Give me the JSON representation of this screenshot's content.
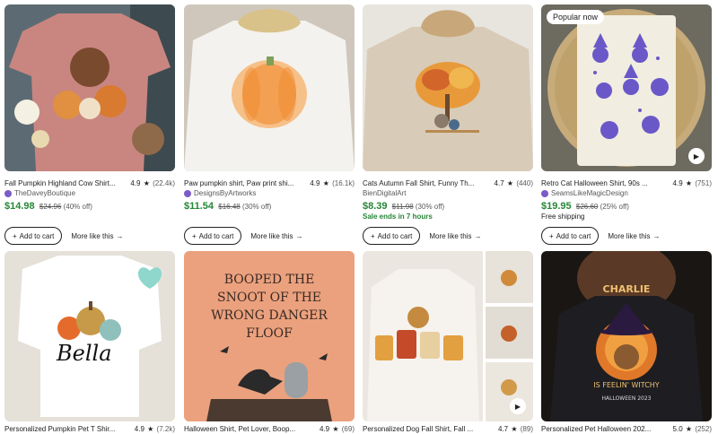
{
  "listings": [
    {
      "title": "Fall Pumpkin Highland Cow Shirt...",
      "rating": "4.9",
      "reviews": "(22.4k)",
      "shop": "TheDaveyBoutique",
      "star_seller": true,
      "price": "$14.98",
      "original_price": "$24.96",
      "discount": "(40% off)",
      "cart_label": "Add to cart",
      "more_label": "More like this"
    },
    {
      "title": "Paw pumpkin shirt, Paw print shi...",
      "rating": "4.9",
      "reviews": "(16.1k)",
      "shop": "DesignsByArtworks",
      "star_seller": true,
      "price": "$11.54",
      "original_price": "$16.48",
      "discount": "(30% off)",
      "cart_label": "Add to cart",
      "more_label": "More like this"
    },
    {
      "title": "Cats Autumn Fall Shirt, Funny Th...",
      "rating": "4.7",
      "reviews": "(440)",
      "shop": "BienDigitalArt",
      "star_seller": false,
      "price": "$8.39",
      "original_price": "$11.98",
      "discount": "(30% off)",
      "note": "Sale ends in 7 hours",
      "cart_label": "Add to cart",
      "more_label": "More like this"
    },
    {
      "badge": "Popular now",
      "title": "Retro Cat Halloween Shirt, 90s ...",
      "rating": "4.9",
      "reviews": "(751)",
      "shop": "SeamsLikeMagicDesign",
      "star_seller": true,
      "price": "$19.95",
      "original_price": "$26.60",
      "discount": "(25% off)",
      "shipping": "Free shipping",
      "cart_label": "Add to cart",
      "more_label": "More like this"
    },
    {
      "title": "Personalized Pumpkin Pet T Shir...",
      "rating": "4.9",
      "reviews": "(7.2k)",
      "image_text": "Bella"
    },
    {
      "title": "Halloween Shirt, Pet Lover, Boop...",
      "rating": "4.9",
      "reviews": "(69)",
      "image_text": [
        "BOOPED THE",
        "SNOOT OF THE",
        "WRONG DANGER",
        "FLOOF"
      ]
    },
    {
      "title": "Personalized Dog Fall Shirt, Fall ...",
      "rating": "4.7",
      "reviews": "(89)"
    },
    {
      "title": "Personalized Pet Halloween 202...",
      "rating": "5.0",
      "reviews": "(252)",
      "image_text": [
        "CHARLIE",
        "IS FEELIN' WITCHY",
        "HALLOWEEN 2023"
      ]
    }
  ],
  "icons": {
    "star": "★",
    "plus": "+",
    "arrow": "→",
    "play": "▶"
  },
  "colors": {
    "sale_green": "#258635",
    "star_seller_purple": "#7b5cc7"
  }
}
